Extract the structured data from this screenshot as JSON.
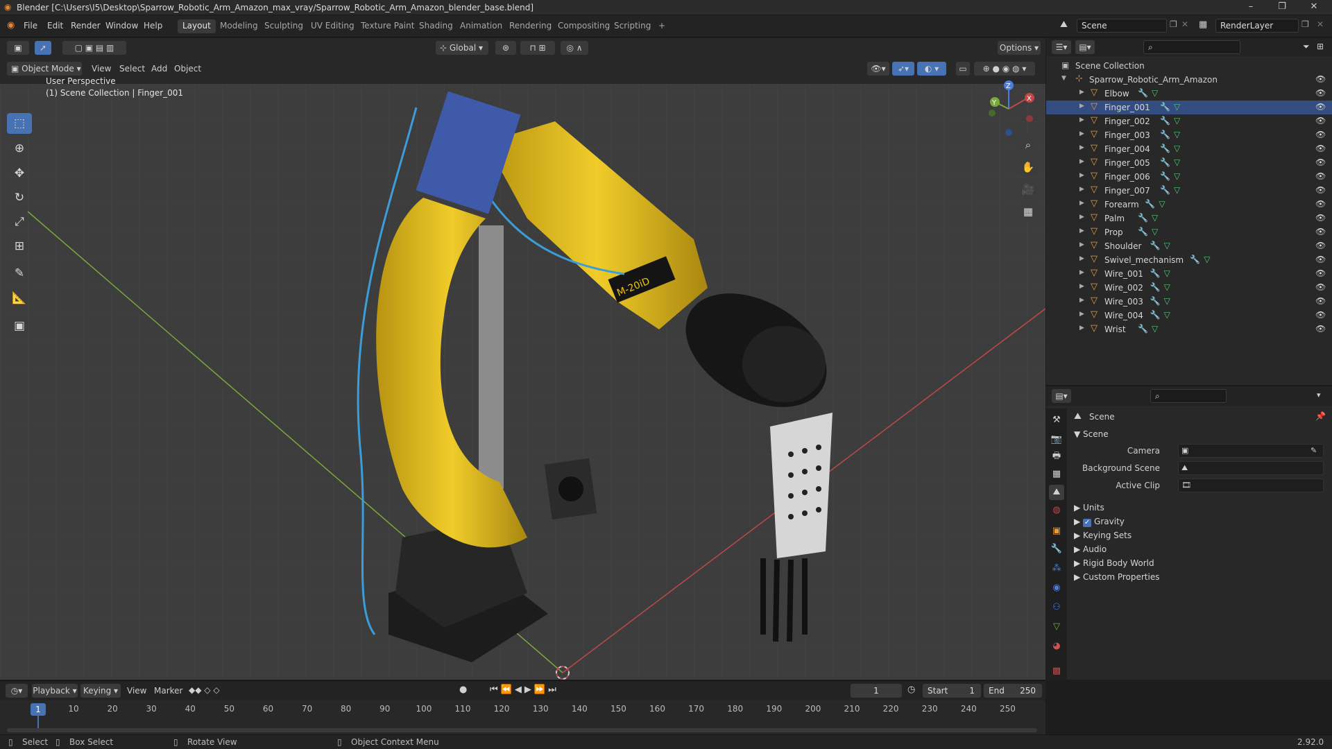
{
  "window": {
    "title": "Blender [C:\\Users\\I5\\Desktop\\Sparrow_Robotic_Arm_Amazon_max_vray/Sparrow_Robotic_Arm_Amazon_blender_base.blend]",
    "minimize": "–",
    "maximize": "❐",
    "close": "✕"
  },
  "menus": [
    "File",
    "Edit",
    "Render",
    "Window",
    "Help"
  ],
  "workspaces": [
    {
      "label": "Layout",
      "active": true
    },
    {
      "label": "Modeling",
      "active": false
    },
    {
      "label": "Sculpting",
      "active": false
    },
    {
      "label": "UV Editing",
      "active": false
    },
    {
      "label": "Texture Paint",
      "active": false
    },
    {
      "label": "Shading",
      "active": false
    },
    {
      "label": "Animation",
      "active": false
    },
    {
      "label": "Rendering",
      "active": false
    },
    {
      "label": "Compositing",
      "active": false
    },
    {
      "label": "Scripting",
      "active": false
    }
  ],
  "add_workspace": "+",
  "scene_selector": {
    "scene": "Scene",
    "view_layer": "RenderLayer"
  },
  "viewport_header": {
    "mode": "Object Mode",
    "menus": [
      "View",
      "Select",
      "Add",
      "Object"
    ],
    "transform_orientation": "Global",
    "options": "Options"
  },
  "viewport_overlay": {
    "line1": "User Perspective",
    "line2": "(1) Scene Collection | Finger_001"
  },
  "gizmo": {
    "x": "X",
    "y": "Y",
    "z": "Z"
  },
  "outliner": {
    "root": "Scene Collection",
    "collection": "Sparrow_Robotic_Arm_Amazon",
    "objects": [
      "Elbow",
      "Finger_001",
      "Finger_002",
      "Finger_003",
      "Finger_004",
      "Finger_005",
      "Finger_006",
      "Finger_007",
      "Forearm",
      "Palm",
      "Prop",
      "Shoulder",
      "Swivel_mechanism",
      "Wire_001",
      "Wire_002",
      "Wire_003",
      "Wire_004",
      "Wrist"
    ],
    "active": "Finger_001"
  },
  "properties": {
    "header": "Scene",
    "panel": "Scene",
    "fields": [
      {
        "label": "Camera"
      },
      {
        "label": "Background Scene"
      },
      {
        "label": "Active Clip"
      }
    ],
    "sections": [
      {
        "label": "Units",
        "checkbox": false
      },
      {
        "label": "Gravity",
        "checkbox": true
      },
      {
        "label": "Keying Sets",
        "checkbox": false
      },
      {
        "label": "Audio",
        "checkbox": false
      },
      {
        "label": "Rigid Body World",
        "checkbox": false
      },
      {
        "label": "Custom Properties",
        "checkbox": false
      }
    ]
  },
  "timeline": {
    "menus": [
      "Playback",
      "Keying",
      "View",
      "Marker"
    ],
    "current_frame": "1",
    "start_label": "Start",
    "start": "1",
    "end_label": "End",
    "end": "250",
    "ticks": [
      "10",
      "20",
      "30",
      "40",
      "50",
      "60",
      "70",
      "80",
      "90",
      "100",
      "110",
      "120",
      "130",
      "140",
      "150",
      "160",
      "170",
      "180",
      "190",
      "200",
      "210",
      "220",
      "230",
      "240",
      "250"
    ],
    "playhead": "1"
  },
  "statusbar": {
    "select": "Select",
    "box_select": "Box Select",
    "rotate_view": "Rotate View",
    "context_menu": "Object Context Menu",
    "version": "2.92.0"
  },
  "colors": {
    "accent": "#4772b3",
    "object_orange": "#e89b3b",
    "robot_yellow": "#e8c21c",
    "axis_x": "#c04848",
    "axis_y": "#7aa83c"
  }
}
